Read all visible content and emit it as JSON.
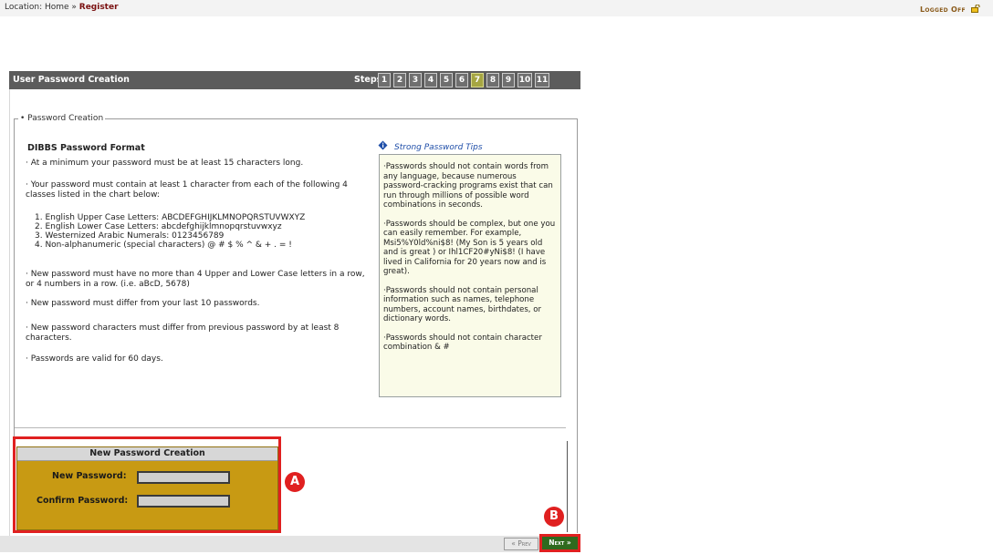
{
  "location": {
    "prefix": "Location: Home » ",
    "current": "Register"
  },
  "logged_off": "Logged Off",
  "header": {
    "title": "User Password Creation",
    "steps_label": "Steps:",
    "steps": [
      "1",
      "2",
      "3",
      "4",
      "5",
      "6",
      "7",
      "8",
      "9",
      "10",
      "11"
    ],
    "active_step": "7"
  },
  "fieldset_legend": "• Password Creation",
  "format": {
    "title": "DIBBS Password Format",
    "rule1": "· At a minimum your password must be at least 15 characters long.",
    "rule2a": "· Your password must contain at least 1 character from each of the following 4",
    "rule2b": "classes listed in the chart below:",
    "list": [
      "1. English Upper Case Letters: ABCDEFGHIJKLMNOPQRSTUVWXYZ",
      "2. English Lower Case Letters: abcdefghijklmnopqrstuvwxyz",
      "3. Westernized Arabic Numerals: 0123456789",
      "4. Non-alphanumeric (special characters) @ # $ % ^ & + . = !"
    ],
    "rule3a": "· New password must have no more than 4 Upper and Lower Case letters in a row,",
    "rule3b": "or 4 numbers in a row. (i.e. aBcD, 5678)",
    "rule4": "· New password must differ from your last 10 passwords.",
    "rule5a": "· New password characters must differ from previous password by at least 8",
    "rule5b": "characters.",
    "rule6": "· Passwords are valid for 60 days."
  },
  "tips": {
    "title": "Strong Password Tips",
    "items": [
      "·Passwords should not contain words from any language, because numerous password-cracking programs exist that can run through millions of possible word combinations in seconds.",
      "·Passwords should be complex, but one you can easily remember. For example, Msi5%Y0ld%ni$8! (My Son is 5 years old and is great ) or Ihl1CF20#yNi$8! (I have lived in California for 20 years now and is great).",
      "·Passwords should not contain personal information such as names, telephone numbers, account names, birthdates, or dictionary words.",
      "·Passwords should not contain character combination & #"
    ]
  },
  "new_password": {
    "header": "New Password Creation",
    "new_label": "New Password:",
    "confirm_label": "Confirm Password:",
    "new_value": "",
    "confirm_value": ""
  },
  "callouts": {
    "a": "A",
    "b": "B"
  },
  "nav": {
    "prev": "« Prev",
    "next": "Next »"
  },
  "colors": {
    "active_step": "#a6a642",
    "next_button": "#2f6a1e",
    "highlight": "#e02020",
    "new_pw_panel": "#c89a13"
  }
}
